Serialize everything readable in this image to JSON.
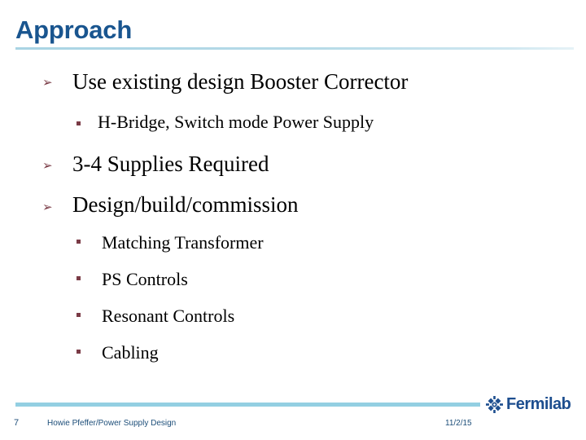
{
  "slide": {
    "title": "Approach",
    "title_color": "#19558f",
    "rule_color": "#b7dbe8",
    "background_color": "#ffffff"
  },
  "body": {
    "marker_level1_glyph": "➢",
    "marker_level1_color": "#7a3b46",
    "marker_level2_color": "#7a3b46",
    "items": [
      {
        "level": 1,
        "text": "Use existing design Booster Corrector"
      },
      {
        "level": 2,
        "text": "H-Bridge, Switch mode Power Supply"
      },
      {
        "level": 1,
        "text": "3-4 Supplies Required"
      },
      {
        "level": 1,
        "text": "Design/build/commission"
      },
      {
        "level": 2,
        "text": "Matching Transformer"
      },
      {
        "level": 2,
        "text": "PS Controls"
      },
      {
        "level": 2,
        "text": "Resonant Controls"
      },
      {
        "level": 2,
        "text": "Cabling"
      }
    ]
  },
  "footer": {
    "page_number": "7",
    "author": "Howie Pfeffer/Power Supply Design",
    "date": "11/2/15",
    "bar_color": "#93cfe2",
    "text_color": "#1d4e79",
    "logo_text": "Fermilab",
    "logo_color": "#1d4e8f"
  }
}
